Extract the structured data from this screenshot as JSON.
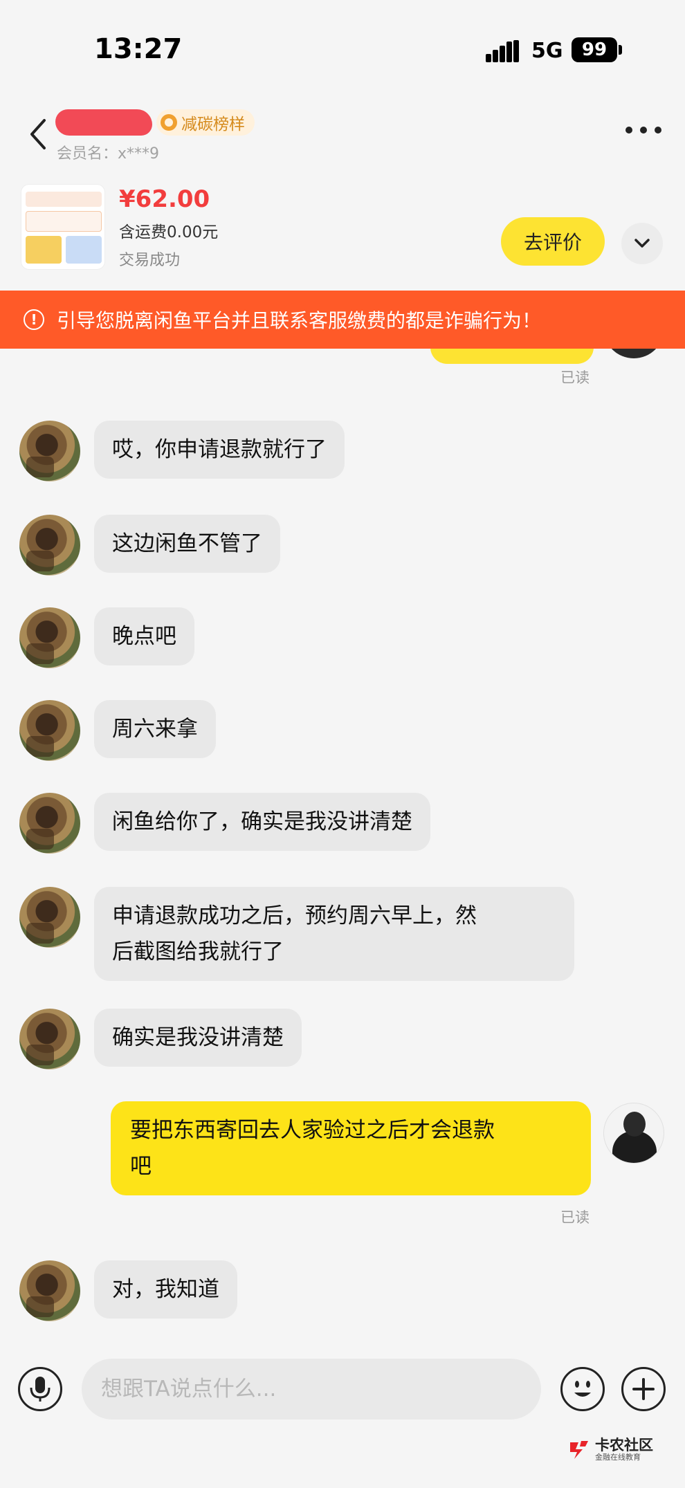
{
  "status_bar": {
    "time": "13:27",
    "network": "5G",
    "battery": "99"
  },
  "header": {
    "badge_label": "减碳榜样",
    "member_label": "会员名：x***9"
  },
  "product": {
    "price": "¥62.00",
    "shipping": "含运费0.00元",
    "status": "交易成功",
    "review_label": "去评价"
  },
  "warning": {
    "text": "引导您脱离闲鱼平台并且联系客服缴费的都是诈骗行为！"
  },
  "chat": {
    "read_label": "已读",
    "messages": [
      {
        "side": "left",
        "text": "哎，你申请退款就行了"
      },
      {
        "side": "left",
        "text": "这边闲鱼不管了"
      },
      {
        "side": "left",
        "text": "晚点吧"
      },
      {
        "side": "left",
        "text": "周六来拿"
      },
      {
        "side": "left",
        "text": "闲鱼给你了，确实是我没讲清楚"
      },
      {
        "side": "left",
        "line1": "申请退款成功之后，预约周六早上，然",
        "line2": "后截图给我就行了"
      },
      {
        "side": "left",
        "text": "确实是我没讲清楚"
      },
      {
        "side": "right",
        "line1": "要把东西寄回去人家验过之后才会退款",
        "line2": "吧"
      },
      {
        "side": "left",
        "text": "对，我知道"
      }
    ]
  },
  "input": {
    "placeholder": "想跟TA说点什么..."
  },
  "watermark": {
    "title": "卡农社区",
    "subtitle": "金融在线教育"
  },
  "colors": {
    "accent_yellow": "#fde332",
    "warning_orange": "#ff5a28",
    "price_red": "#f23d3d"
  }
}
